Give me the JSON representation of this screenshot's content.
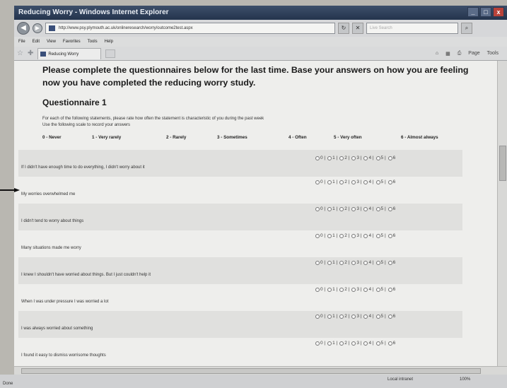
{
  "window": {
    "title": "Reducing Worry - Windows Internet Explorer",
    "minimize": "_",
    "maximize": "□",
    "close": "x"
  },
  "address": {
    "url": "http://www.psy.plymouth.ac.uk/onlineresearch/worry/outcome2test.aspx",
    "search_placeholder": "Live Search"
  },
  "menu": [
    "File",
    "Edit",
    "View",
    "Favorites",
    "Tools",
    "Help"
  ],
  "tab": {
    "label": "Reducing Worry"
  },
  "commandbar": [
    "Page",
    "Tools"
  ],
  "page": {
    "intro": "Please complete the questionnaires below for the last time. Base your answers on how you are feeling now you have completed the reducing worry study.",
    "questionnaire_title": "Questionnaire 1",
    "instruction_line1": "For each of the following statements, please rate how often the statement is characteristic of you during the past week",
    "instruction_line2": "Use the following scale to record your answers",
    "scale": [
      "0 - Never",
      "1 - Very rarely",
      "2 - Rarely",
      "3 - Sometimes",
      "4 - Often",
      "5 - Very often",
      "6 - Almost always"
    ],
    "option_labels": [
      "0 |",
      "1 |",
      "2 |",
      "3 |",
      "4 |",
      "5 |",
      "6"
    ],
    "statements": [
      "If I didn't have enough time to do everything, I didn't worry about it",
      "My worries overwhelmed me",
      "I didn't tend to worry about things",
      "Many situations made me worry",
      "I knew I shouldn't have worried about things. But I just couldn't help it",
      "When I was under pressure I was worried a lot",
      "I was always worried about something",
      "I found it easy to dismiss worrisome thoughts"
    ]
  },
  "status": {
    "done": "Done",
    "zone": "Local intranet",
    "zoom": "100%"
  }
}
